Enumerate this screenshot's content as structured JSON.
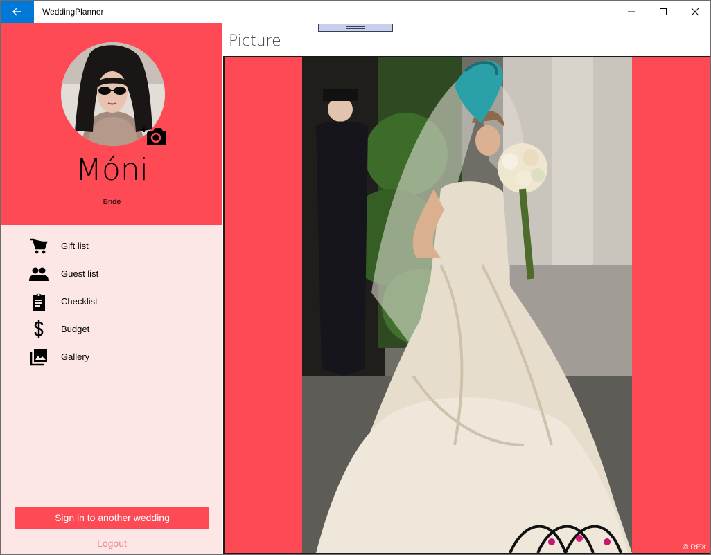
{
  "app": {
    "title": "WeddingPlanner"
  },
  "profile": {
    "name": "Móni",
    "role": "Bride"
  },
  "nav": {
    "items": [
      {
        "label": "Gift list",
        "icon": "cart-icon"
      },
      {
        "label": "Guest list",
        "icon": "people-icon"
      },
      {
        "label": "Checklist",
        "icon": "clipboard-icon"
      },
      {
        "label": "Budget",
        "icon": "dollar-icon"
      },
      {
        "label": "Gallery",
        "icon": "gallery-icon"
      }
    ]
  },
  "footer": {
    "signin_label": "Sign in to another wedding",
    "logout_label": "Logout"
  },
  "main": {
    "title": "Picture",
    "watermark": "© REX"
  },
  "colors": {
    "accent": "#fe4a54",
    "sidebar_bg": "#fce6e6",
    "titlebar_back": "#0078d7",
    "logout_text": "#f08a8f"
  }
}
